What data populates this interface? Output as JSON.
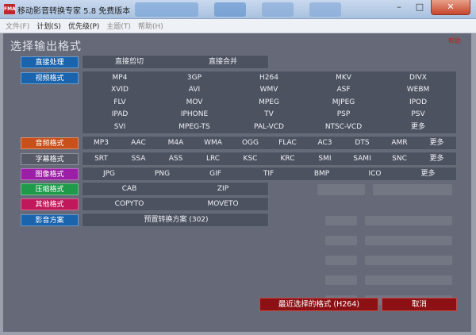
{
  "window": {
    "icon_text": "FMA",
    "title": "移动影音转换专家 5.8 免费版本",
    "controls": {
      "minimize": "–",
      "maximize": "□",
      "close": "✕"
    }
  },
  "menu": [
    {
      "label": "文件(F)",
      "enabled": false
    },
    {
      "label": "计划(S)",
      "enabled": true
    },
    {
      "label": "优先级(P)",
      "enabled": true
    },
    {
      "label": "主题(T)",
      "enabled": false
    },
    {
      "label": "帮助(H)",
      "enabled": false
    }
  ],
  "dialog": {
    "heading": "选择输出格式",
    "help": "帮助",
    "categories": {
      "direct": {
        "label": "直接处理",
        "color": "#1a63ad",
        "options": [
          "直接剪切",
          "直接合并"
        ]
      },
      "video": {
        "label": "视频格式",
        "color": "#1a63ad",
        "options": [
          "MP4",
          "3GP",
          "H264",
          "MKV",
          "DIVX",
          "XVID",
          "AVI",
          "WMV",
          "ASF",
          "WEBM",
          "FLV",
          "MOV",
          "MPEG",
          "MJPEG",
          "IPOD",
          "IPAD",
          "IPHONE",
          "TV",
          "PSP",
          "PSV",
          "SVI",
          "MPEG-TS",
          "PAL-VCD",
          "NTSC-VCD",
          "更多"
        ]
      },
      "audio": {
        "label": "音频格式",
        "color": "#c8501a",
        "options": [
          "MP3",
          "AAC",
          "M4A",
          "WMA",
          "OGG",
          "FLAC",
          "AC3",
          "DTS",
          "AMR",
          "更多"
        ]
      },
      "subtitle": {
        "label": "字幕格式",
        "color": "#555a66",
        "options": [
          "SRT",
          "SSA",
          "ASS",
          "LRC",
          "KSC",
          "KRC",
          "SMI",
          "SAMI",
          "SNC",
          "更多"
        ]
      },
      "image": {
        "label": "图像格式",
        "color": "#9b1fa6",
        "options": [
          "JPG",
          "PNG",
          "GIF",
          "TIF",
          "BMP",
          "ICO",
          "更多"
        ]
      },
      "compress": {
        "label": "压缩格式",
        "color": "#1f9a4a",
        "options": [
          "CAB",
          "ZIP"
        ]
      },
      "other": {
        "label": "其他格式",
        "color": "#c0185a",
        "options": [
          "COPYTO",
          "MOVETO"
        ]
      },
      "preset": {
        "label": "影音方案",
        "color": "#1a63ad",
        "options": [
          "预置转换方案 (302)"
        ]
      }
    },
    "buttons": {
      "recent": "最近选择的格式 (H264)",
      "cancel": "取消"
    }
  }
}
